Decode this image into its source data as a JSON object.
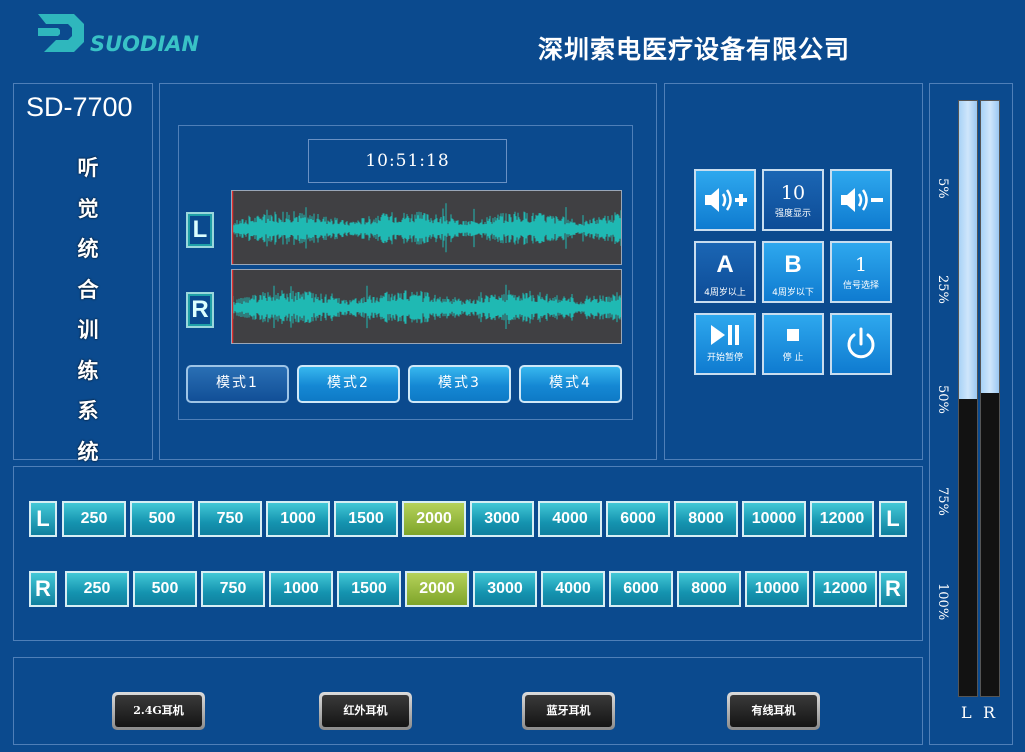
{
  "header": {
    "logo_text": "SUODIAN",
    "company": "深圳索电医疗设备有限公司"
  },
  "device": {
    "model": "SD-7700",
    "title_chars": [
      "听",
      "觉",
      "统",
      "合",
      "训",
      "练",
      "系",
      "统"
    ]
  },
  "player": {
    "time": "10:51:18",
    "left_tag": "L",
    "right_tag": "R",
    "modes": [
      "模式1",
      "模式2",
      "模式3",
      "模式4"
    ],
    "active_mode": 0
  },
  "controls": {
    "volume_up_icon": "speaker-plus-icon",
    "intensity_value": "10",
    "intensity_label": "强度显示",
    "volume_down_icon": "speaker-minus-icon",
    "a_label": "A",
    "a_sub": "4周岁以上",
    "b_label": "B",
    "b_sub": "4周岁以下",
    "signal_value": "1",
    "signal_label": "信号选择",
    "playpause_label": "开始暂停",
    "stop_label": "停 止",
    "power_icon": "power-icon"
  },
  "frequencies": {
    "left_tag": "L",
    "right_tag": "R",
    "values": [
      "250",
      "500",
      "750",
      "1000",
      "1500",
      "2000",
      "3000",
      "4000",
      "6000",
      "8000",
      "10000",
      "12000"
    ],
    "selected_left": "2000",
    "selected_right": "2000"
  },
  "earphones": [
    "2.4G耳机",
    "红外耳机",
    "蓝牙耳机",
    "有线耳机"
  ],
  "meters": {
    "scale": [
      "5%",
      "25%",
      "50%",
      "75%",
      "100%"
    ],
    "left_label": "L",
    "right_label": "R",
    "left_level_fraction": 0.5,
    "right_level_fraction": 0.49
  },
  "colors": {
    "background": "#0b4a8e",
    "waveform": "#1fb9b3",
    "selected_freq": "#9cbf3f"
  }
}
